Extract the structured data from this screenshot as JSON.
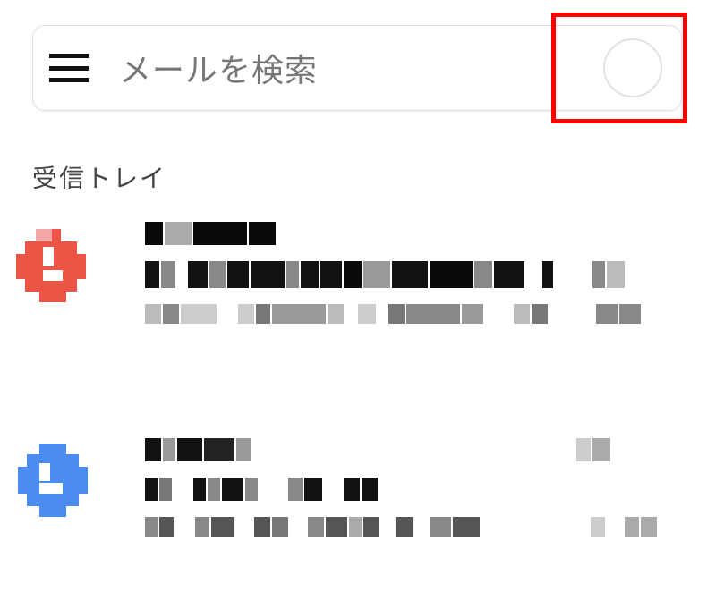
{
  "search": {
    "placeholder": "メールを検索"
  },
  "section_label": "受信トレイ",
  "colors": {
    "avatar1": "#eb5545",
    "avatar2": "#4a8cf0"
  }
}
